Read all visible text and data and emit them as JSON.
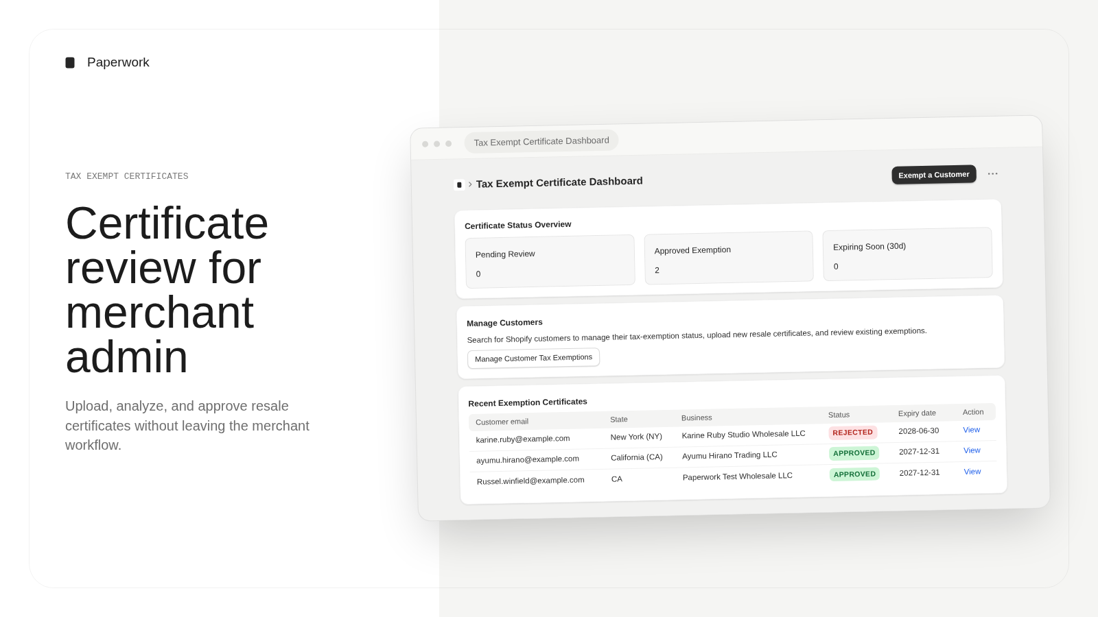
{
  "brand": {
    "name": "Paperwork"
  },
  "hero": {
    "eyebrow": "TAX EXEMPT CERTIFICATES",
    "headline": "Certificate review for merchant admin",
    "description": "Upload, analyze, and approve resale certificates without leaving the merchant workflow."
  },
  "browser_window": {
    "tab_title": "Tax Exempt Certificate Dashboard",
    "page_header": {
      "title": "Tax Exempt Certificate Dashboard",
      "primary_button": "Exempt a Customer"
    },
    "status_overview": {
      "title": "Certificate Status Overview",
      "stats": [
        {
          "label": "Pending Review",
          "value": "0"
        },
        {
          "label": "Approved Exemption",
          "value": "2"
        },
        {
          "label": "Expiring Soon (30d)",
          "value": "0"
        }
      ]
    },
    "manage_customers": {
      "title": "Manage Customers",
      "description": "Search for Shopify customers to manage their tax-exemption status, upload new resale certificates, and review existing exemptions.",
      "button": "Manage Customer Tax Exemptions"
    },
    "recent_certificates": {
      "title": "Recent Exemption Certificates",
      "columns": [
        "Customer email",
        "State",
        "Business",
        "Status",
        "Expiry date",
        "Action"
      ],
      "rows": [
        {
          "customer_email": "karine.ruby@example.com",
          "state": "New York (NY)",
          "business": "Karine Ruby Studio Wholesale LLC",
          "status": {
            "text": "REJECTED",
            "kind": "rejected"
          },
          "expiry_date": "2028-06-30",
          "action": "View"
        },
        {
          "customer_email": "ayumu.hirano@example.com",
          "state": "California (CA)",
          "business": "Ayumu Hirano Trading LLC",
          "status": {
            "text": "APPROVED",
            "kind": "approved"
          },
          "expiry_date": "2027-12-31",
          "action": "View"
        },
        {
          "customer_email": "Russel.winfield@example.com",
          "state": "CA",
          "business": "Paperwork Test Wholesale LLC",
          "status": {
            "text": "APPROVED",
            "kind": "approved"
          },
          "expiry_date": "2027-12-31",
          "action": "View"
        }
      ]
    }
  }
}
